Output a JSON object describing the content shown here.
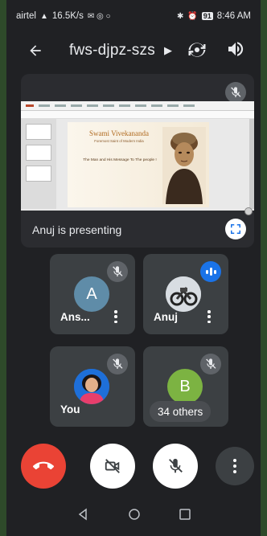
{
  "status_bar": {
    "carrier": "airtel",
    "signal": "4G",
    "speed": "16.5K/s",
    "battery": "91",
    "time": "8:46 AM"
  },
  "header": {
    "meeting_code": "fws-djpz-szs",
    "back_icon": "arrow-left-icon",
    "flip_camera_icon": "flip-camera-icon",
    "speaker_icon": "speaker-icon"
  },
  "presentation": {
    "label": "Anuj is presenting",
    "slide": {
      "title": "Swami Vivekananda",
      "subtitle": "Foremost Saint of Modern India",
      "message": "The Man and His Message  To The people !"
    }
  },
  "participants": [
    {
      "name": "Ans...",
      "initial": "A",
      "avatar_color": "#5f8ca8",
      "muted": true
    },
    {
      "name": "Anuj",
      "initial": "",
      "avatar_color": "#cfd6dc",
      "muted": false,
      "speaking": true
    },
    {
      "name": "You",
      "initial": "",
      "avatar_color": "#1e6fd9",
      "muted": true
    },
    {
      "name": "B",
      "initial": "B",
      "avatar_color": "#7cb342",
      "muted": true,
      "others_label": "34 others"
    }
  ],
  "controls": {
    "end_call_icon": "end-call-icon",
    "camera_icon": "camera-off-icon",
    "mic_icon": "mic-off-icon",
    "more_icon": "more-vert-icon"
  },
  "colors": {
    "background": "#202124",
    "tile": "#3c4043",
    "end_call": "#ea4335",
    "speaking": "#1a73e8"
  }
}
